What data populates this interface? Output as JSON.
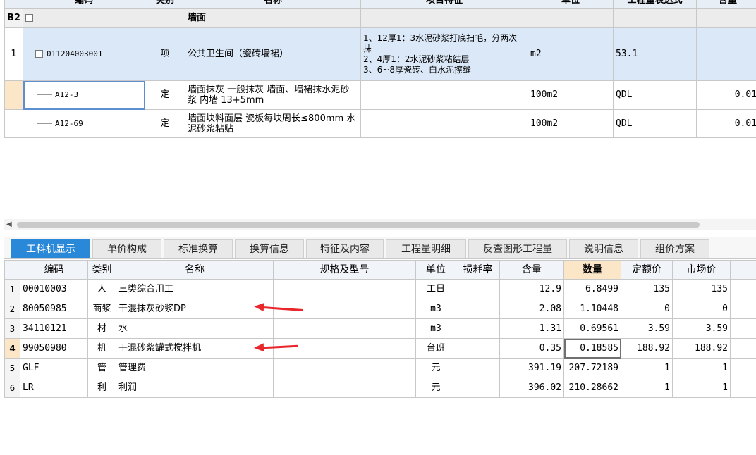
{
  "top_table": {
    "headers": [
      "编码",
      "类别",
      "名称",
      "项目特征",
      "单位",
      "工程量表达式",
      "含量"
    ],
    "rows": [
      {
        "row_no": "B2",
        "code": "",
        "type": "",
        "name": "墙面",
        "feature": "",
        "unit": "",
        "expr": "",
        "content": ""
      },
      {
        "row_no": "1",
        "code": "011204003001",
        "type": "项",
        "name": "公共卫生间（瓷砖墙裙）",
        "feature": "1、12厚1：3水泥砂浆打底扫毛，分两次抹\n2、4厚1：2水泥砂浆粘结层\n3、6~8厚瓷砖、白水泥擦缝",
        "unit": "m2",
        "expr": "53.1",
        "content": ""
      },
      {
        "row_no": "",
        "code": "A12-3",
        "type": "定",
        "name": "墙面抹灰 一般抹灰 墙面、墙裙抹水泥砂浆 内墙 13+5mm",
        "feature": "",
        "unit": "100m2",
        "expr": "QDL",
        "content": "0.01"
      },
      {
        "row_no": "",
        "code": "A12-69",
        "type": "定",
        "name": "墙面块料面层 瓷板每块周长≤800mm 水泥砂浆粘贴",
        "feature": "",
        "unit": "100m2",
        "expr": "QDL",
        "content": "0.01"
      }
    ]
  },
  "tabs": [
    "工料机显示",
    "单价构成",
    "标准换算",
    "换算信息",
    "特征及内容",
    "工程量明细",
    "反查图形工程量",
    "说明信息",
    "组价方案"
  ],
  "active_tab": "工料机显示",
  "bottom_table": {
    "headers": [
      "",
      "编码",
      "类别",
      "名称",
      "规格及型号",
      "单位",
      "损耗率",
      "含量",
      "数量",
      "定额价",
      "市场价",
      ""
    ],
    "rows": [
      {
        "no": "1",
        "code": "00010003",
        "type": "人",
        "name": "三类综合用工",
        "spec": "",
        "unit": "工日",
        "loss": "",
        "content": "12.9",
        "qty": "6.8499",
        "price": "135",
        "market": "135"
      },
      {
        "no": "2",
        "code": "80050985",
        "type": "商浆",
        "name": "干混抹灰砂浆DP",
        "spec": "",
        "unit": "m3",
        "loss": "",
        "content": "2.08",
        "qty": "1.10448",
        "price": "0",
        "market": "0"
      },
      {
        "no": "3",
        "code": "34110121",
        "type": "材",
        "name": "水",
        "spec": "",
        "unit": "m3",
        "loss": "",
        "content": "1.31",
        "qty": "0.69561",
        "price": "3.59",
        "market": "3.59"
      },
      {
        "no": "4",
        "code": "99050980",
        "type": "机",
        "name": "干混砂浆罐式搅拌机",
        "spec": "",
        "unit": "台班",
        "loss": "",
        "content": "0.35",
        "qty": "0.18585",
        "price": "188.92",
        "market": "188.92"
      },
      {
        "no": "5",
        "code": "GLF",
        "type": "管",
        "name": "管理费",
        "spec": "",
        "unit": "元",
        "loss": "",
        "content": "391.19",
        "qty": "207.72189",
        "price": "1",
        "market": "1"
      },
      {
        "no": "6",
        "code": "LR",
        "type": "利",
        "name": "利润",
        "spec": "",
        "unit": "元",
        "loss": "",
        "content": "396.02",
        "qty": "210.28662",
        "price": "1",
        "market": "1"
      }
    ]
  },
  "colors": {
    "tab_active": "#2a88d8",
    "header_highlight": "#fbe7c8",
    "annotation_arrow": "#e8262b",
    "selected_row": "#dbe8f7"
  }
}
